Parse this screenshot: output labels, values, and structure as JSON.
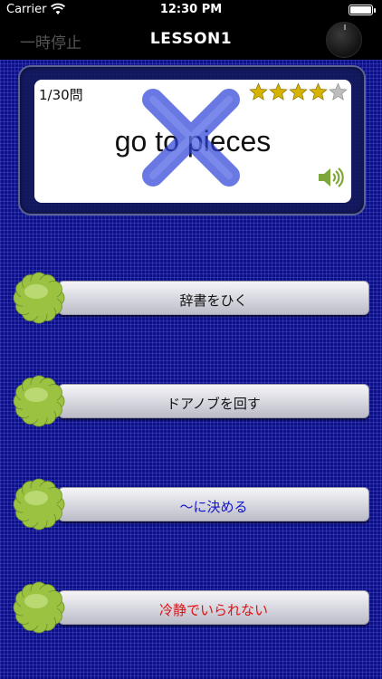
{
  "status_bar": {
    "carrier": "Carrier",
    "time": "12:30 PM"
  },
  "nav": {
    "pause_label": "一時停止",
    "title": "LESSON1"
  },
  "card": {
    "counter": "1/30問",
    "phrase": "go to pieces",
    "rating": 4,
    "max_rating": 5,
    "result_mark": "x-icon"
  },
  "options": [
    {
      "label": "辞書をひく",
      "color": "#111111"
    },
    {
      "label": "ドアノブを回す",
      "color": "#111111"
    },
    {
      "label": "～に決める",
      "color": "#1515c8"
    },
    {
      "label": "冷静でいられない",
      "color": "#e01010"
    }
  ],
  "colors": {
    "background": "#0c0f86",
    "star_filled": "#d6b300",
    "star_empty": "#bdbdbd",
    "flower": "#9bc241"
  }
}
